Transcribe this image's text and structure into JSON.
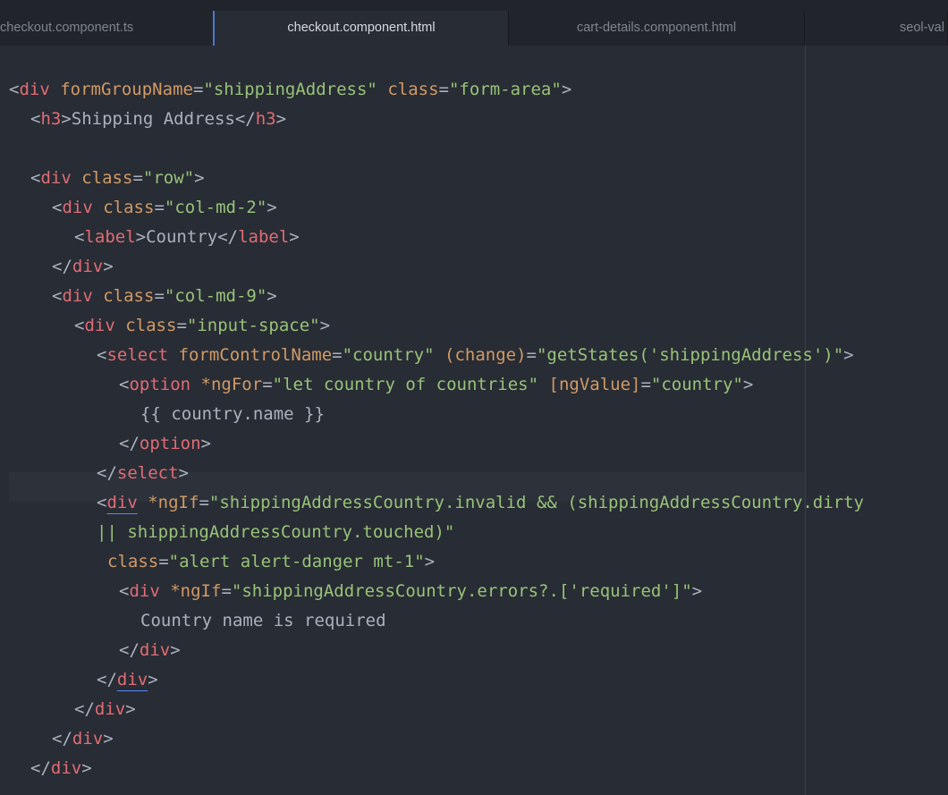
{
  "tabs": [
    {
      "label": "checkout.component.ts"
    },
    {
      "label": "checkout.component.html"
    },
    {
      "label": "cart-details.component.html"
    },
    {
      "label": "seol-val"
    }
  ],
  "code": {
    "l1": {
      "lt1": "<",
      "tag1": "div",
      "attr1": "formGroupName",
      "eq1": "=",
      "str1": "\"shippingAddress\"",
      "attr2": "class",
      "eq2": "=",
      "str2": "\"form-area\"",
      "gt1": ">"
    },
    "l2": {
      "lt1": "<",
      "tag1": "h3",
      "gt1": ">",
      "text1": "Shipping Address",
      "lt2": "</",
      "tag2": "h3",
      "gt2": ">"
    },
    "l4": {
      "lt1": "<",
      "tag1": "div",
      "attr1": "class",
      "eq1": "=",
      "str1": "\"row\"",
      "gt1": ">"
    },
    "l5": {
      "lt1": "<",
      "tag1": "div",
      "attr1": "class",
      "eq1": "=",
      "str1": "\"col-md-2\"",
      "gt1": ">"
    },
    "l6": {
      "lt1": "<",
      "tag1": "label",
      "gt1": ">",
      "text1": "Country",
      "lt2": "</",
      "tag2": "label",
      "gt2": ">"
    },
    "l7": {
      "lt1": "</",
      "tag1": "div",
      "gt1": ">"
    },
    "l8": {
      "lt1": "<",
      "tag1": "div",
      "attr1": "class",
      "eq1": "=",
      "str1": "\"col-md-9\"",
      "gt1": ">"
    },
    "l9": {
      "lt1": "<",
      "tag1": "div",
      "attr1": "class",
      "eq1": "=",
      "str1": "\"input-space\"",
      "gt1": ">"
    },
    "l10": {
      "lt1": "<",
      "tag1": "select",
      "attr1": "formControlName",
      "eq1": "=",
      "str1": "\"country\"",
      "attr2": "(change)",
      "eq2": "=",
      "str2": "\"getStates('shippingAddress')\"",
      "gt1": ">"
    },
    "l11": {
      "lt1": "<",
      "tag1": "option",
      "attr1": "*ngFor",
      "eq1": "=",
      "str1": "\"let country of countries\"",
      "attr2": "[ngValue]",
      "eq2": "=",
      "str2": "\"country\"",
      "gt1": ">"
    },
    "l12": {
      "text1": "{{ country.name }}"
    },
    "l13": {
      "lt1": "</",
      "tag1": "option",
      "gt1": ">"
    },
    "l14": {
      "lt1": "</",
      "tag1": "select",
      "gt1": ">"
    },
    "l15": {
      "lt1": "<",
      "tag1": "div",
      "attr1": "*ngIf",
      "eq1": "=",
      "str1": "\"shippingAddressCountry.invalid && (shippingAddressCountry.dirty"
    },
    "l16": {
      "str1": "|| shippingAddressCountry.touched)\""
    },
    "l17": {
      "attr1": "class",
      "eq1": "=",
      "str1": "\"alert alert-danger mt-1\"",
      "gt1": ">"
    },
    "l18": {
      "lt1": "<",
      "tag1": "div",
      "attr1": "*ngIf",
      "eq1": "=",
      "str1": "\"shippingAddressCountry.errors?.['required']\"",
      "gt1": ">"
    },
    "l19": {
      "text1": "Country name is required"
    },
    "l20": {
      "lt1": "</",
      "tag1": "div",
      "gt1": ">"
    },
    "l21": {
      "lt1": "</",
      "tag1": "div",
      "gt1": ">"
    },
    "l22": {
      "lt1": "</",
      "tag1": "div",
      "gt1": ">"
    },
    "l23": {
      "lt1": "</",
      "tag1": "div",
      "gt1": ">"
    },
    "l24": {
      "lt1": "</",
      "tag1": "div",
      "gt1": ">"
    }
  },
  "colors": {
    "background": "#282c34",
    "tab_bar": "#21252b",
    "tag": "#e06c75",
    "attribute": "#d19a66",
    "string": "#98c379",
    "text": "#abb2bf",
    "active_tab_accent": "#4d78cc"
  }
}
